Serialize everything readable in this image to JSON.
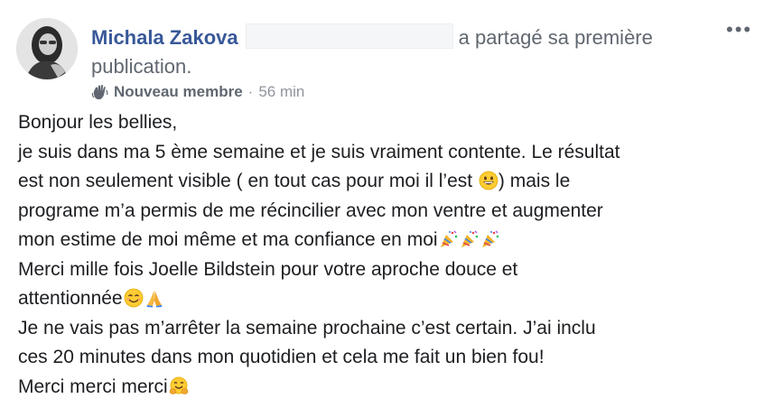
{
  "post": {
    "author": "Michala Zakova",
    "action_line1": "a partagé sa première",
    "action_line2": "publication.",
    "badge": "Nouveau membre",
    "separator": "·",
    "time": "56 min",
    "more_icon": "more-options-icon",
    "lines": [
      "Bonjour les bellies,",
      "je suis dans ma 5 ème semaine et je suis vraiment contente. Le résultat",
      "est non seulement visible ( en tout cas pour moi il l’est ",
      " mais le",
      "programe m’a permis de me récincilier avec mon ventre et augmenter",
      "mon estime de moi même et ma confiance en moi",
      "Merci mille fois Joelle Bildstein pour votre aproche douce et",
      "attentionnée",
      "Je ne vais pas m’arrêter la semaine prochaine c’est certain. J’ai inclu",
      "ces 20 minutes dans mon quotidien et cela me fait un bien fou!",
      "Merci merci merci"
    ],
    "line3_close": ")",
    "emojis": {
      "grin": "grinning-face-emoji",
      "party": "party-popper-emoji",
      "smile": "smiling-face-emoji",
      "pray": "folded-hands-emoji",
      "hug": "hugging-face-emoji"
    }
  }
}
